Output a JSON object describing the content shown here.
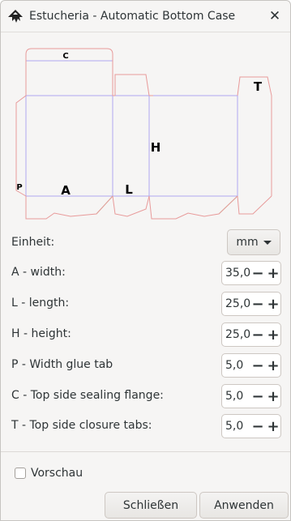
{
  "window": {
    "title": "Estucheria - Automatic Bottom Case"
  },
  "preview": {
    "label_c": "C",
    "label_t": "T",
    "label_h": "H",
    "label_p": "P",
    "label_a": "A",
    "label_l": "L"
  },
  "unit": {
    "label": "Einheit:",
    "value": "mm"
  },
  "params": [
    {
      "label": "A - width:",
      "value": "35,0"
    },
    {
      "label": "L - length:",
      "value": "25,0"
    },
    {
      "label": "H - height:",
      "value": "25,0"
    },
    {
      "label": "P - Width glue tab",
      "value": "5,0"
    },
    {
      "label": "C - Top side sealing flange:",
      "value": "5,0"
    },
    {
      "label": "T - Top side closure tabs:",
      "value": "5,0"
    }
  ],
  "preview_toggle": {
    "label": "Vorschau",
    "checked": false
  },
  "buttons": {
    "close": "Schließen",
    "apply": "Anwenden"
  },
  "colors": {
    "cut_line": "#e89a9a",
    "fold_line": "#b0a8f0",
    "glue_line": "#a8dca0"
  }
}
